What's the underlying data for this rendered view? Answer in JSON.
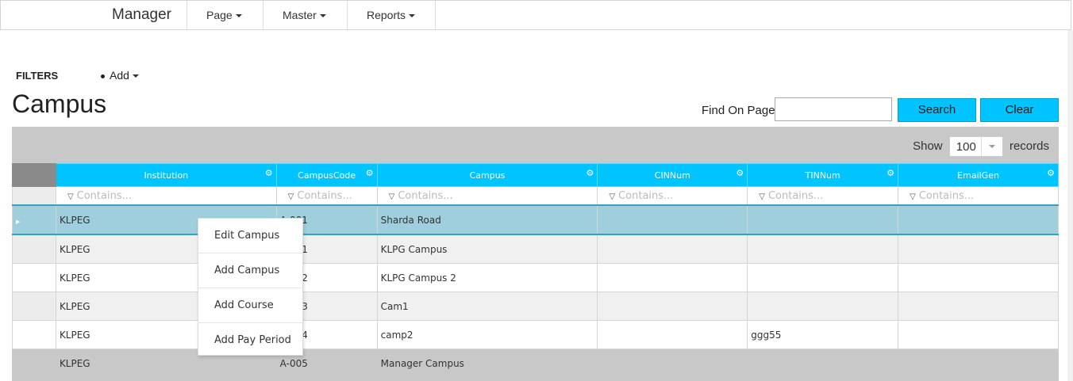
{
  "navbar": {
    "brand": "Manager",
    "menus": [
      {
        "label": "Page"
      },
      {
        "label": "Master"
      },
      {
        "label": "Reports"
      }
    ]
  },
  "toolbar": {
    "filters_label": "FILTERS",
    "add_label": "Add"
  },
  "page_title": "Campus",
  "find": {
    "label": "Find On Page",
    "value": "",
    "search_label": "Search",
    "clear_label": "Clear"
  },
  "grid": {
    "show_label": "Show",
    "page_size": "100",
    "records_label": "records",
    "filter_placeholder": "Contains...",
    "columns": [
      "Institution",
      "CampusCode",
      "Campus",
      "CINNum",
      "TINNum",
      "EmailGen"
    ],
    "rows": [
      {
        "institution": "KLPEG",
        "code": "A-001",
        "campus": "Sharda Road",
        "cin": "",
        "tin": "",
        "email": ""
      },
      {
        "institution": "KLPEG",
        "code": "A-001",
        "campus": "KLPG Campus",
        "cin": "",
        "tin": "",
        "email": ""
      },
      {
        "institution": "KLPEG",
        "code": "A-002",
        "campus": "KLPG Campus 2",
        "cin": "",
        "tin": "",
        "email": ""
      },
      {
        "institution": "KLPEG",
        "code": "A-003",
        "campus": "Cam1",
        "cin": "",
        "tin": "",
        "email": ""
      },
      {
        "institution": "KLPEG",
        "code": "A-004",
        "campus": "camp2",
        "cin": "",
        "tin": "ggg55",
        "email": ""
      },
      {
        "institution": "KLPEG",
        "code": "A-005",
        "campus": "Manager Campus",
        "cin": "",
        "tin": "",
        "email": ""
      }
    ]
  },
  "context_menu": {
    "items": [
      "Edit Campus",
      "Add Campus",
      "Add Course",
      "Add Pay Period"
    ]
  },
  "colors": {
    "accent": "#00c4ff",
    "selected_row": "#9fcfdc",
    "grid_bg": "#c8c8c8"
  }
}
